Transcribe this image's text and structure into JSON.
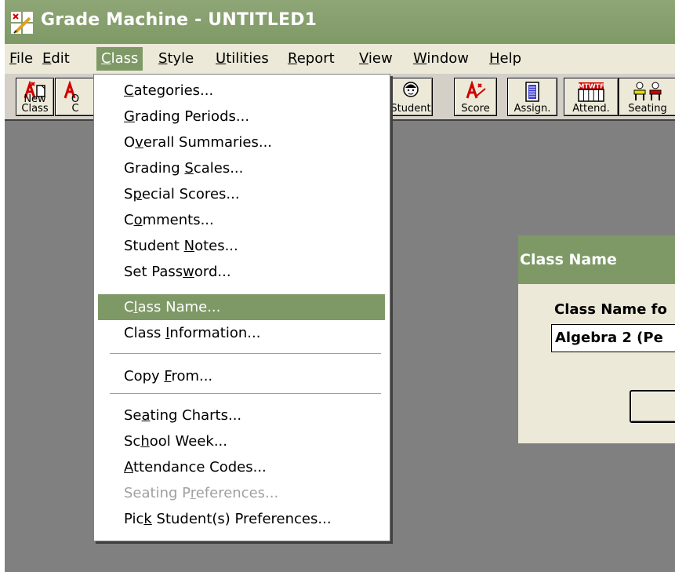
{
  "window": {
    "title": "Grade Machine - UNTITLED1"
  },
  "menubar": {
    "items": [
      {
        "label": "File",
        "u": "F"
      },
      {
        "label": "Edit",
        "u": "E"
      },
      {
        "label": "Class",
        "u": "C"
      },
      {
        "label": "Style",
        "u": "S"
      },
      {
        "label": "Utilities",
        "u": "U"
      },
      {
        "label": "Report",
        "u": "R"
      },
      {
        "label": "View",
        "u": "V"
      },
      {
        "label": "Window",
        "u": "W"
      },
      {
        "label": "Help",
        "u": "H"
      }
    ]
  },
  "toolbar": {
    "buttons": [
      {
        "label1": "New",
        "label2": "Class",
        "icon": "new-class-icon"
      },
      {
        "label1": "O",
        "label2": "C",
        "icon": "open-class-icon"
      },
      {
        "label1": "Student",
        "label2": "",
        "icon": "student-icon"
      },
      {
        "label1": "Score",
        "label2": "",
        "icon": "score-icon"
      },
      {
        "label1": "Assign.",
        "label2": "",
        "icon": "assignment-icon"
      },
      {
        "label1": "Attend.",
        "label2": "",
        "icon": "attendance-icon",
        "icon_text": "MTWTF"
      },
      {
        "label1": "Seating",
        "label2": "",
        "icon": "seating-icon"
      }
    ]
  },
  "class_menu": {
    "items": [
      {
        "pre": "",
        "u": "C",
        "post": "ategories..."
      },
      {
        "pre": "",
        "u": "G",
        "post": "rading Periods..."
      },
      {
        "pre": "O",
        "u": "v",
        "post": "erall Summaries..."
      },
      {
        "pre": "Grading ",
        "u": "S",
        "post": "cales..."
      },
      {
        "pre": "S",
        "u": "p",
        "post": "ecial Scores..."
      },
      {
        "pre": "C",
        "u": "o",
        "post": "mments..."
      },
      {
        "pre": "Student ",
        "u": "N",
        "post": "otes..."
      },
      {
        "pre": "Set Pass",
        "u": "w",
        "post": "ord..."
      },
      {
        "pre": "C",
        "u": "l",
        "post": "ass Name..."
      },
      {
        "pre": "Class ",
        "u": "I",
        "post": "nformation..."
      },
      {
        "pre": "Copy ",
        "u": "F",
        "post": "rom..."
      },
      {
        "pre": "Se",
        "u": "a",
        "post": "ting Charts..."
      },
      {
        "pre": "Sc",
        "u": "h",
        "post": "ool Week..."
      },
      {
        "pre": "",
        "u": "A",
        "post": "ttendance Codes..."
      },
      {
        "pre": "Seating P",
        "u": "r",
        "post": "eferences..."
      },
      {
        "pre": "Pic",
        "u": "k",
        "post": " Student(s) Preferences..."
      }
    ]
  },
  "dialog": {
    "title": "Class Name",
    "label": "Class Name fo",
    "value": "Algebra 2  (Pe"
  },
  "colors": {
    "accent": "#7e9966",
    "menu_bg": "#ece9d8",
    "desktop": "#808080"
  }
}
